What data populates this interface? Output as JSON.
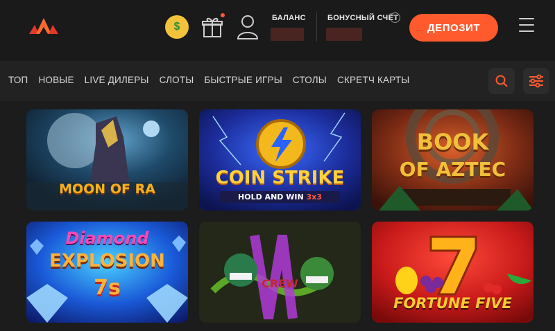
{
  "header": {
    "balance_label": "БАЛАНС",
    "bonus_label": "БОНУСНЫЙ СЧЁТ",
    "bonus_info": "?",
    "deposit_label": "ДЕПОЗИТ",
    "promo_emoji": "$"
  },
  "nav": {
    "items": [
      {
        "label": "ТОП"
      },
      {
        "label": "НОВЫЕ"
      },
      {
        "label": "LIVE ДИЛЕРЫ"
      },
      {
        "label": "СЛОТЫ"
      },
      {
        "label": "БЫСТРЫЕ ИГРЫ"
      },
      {
        "label": "СТОЛЫ"
      },
      {
        "label": "СКРЕТЧ КАРТЫ"
      }
    ]
  },
  "games": [
    {
      "title": "MOON OF RA",
      "title_color": "#f5b21a"
    },
    {
      "title": "COIN STRIKE",
      "subtitle": "HOLD AND WIN",
      "subtitle_extra": "3x3",
      "title_color": "#ffd23a"
    },
    {
      "title_line1": "BOOK",
      "title_line2": "OF AZTEC",
      "title_color": "#f0c03a"
    },
    {
      "title_line1": "Diamond",
      "title_line2": "EXPLOSION",
      "title_line3": "7s",
      "title_color": "#ffb23a"
    },
    {
      "title": "CREW",
      "title_color": "#c02830"
    },
    {
      "title": "FORTUNE FIVE",
      "title_color": "#ffcc33"
    }
  ],
  "colors": {
    "accent": "#ff5a2d",
    "background": "#1c1c1c",
    "nav_background": "#222222"
  }
}
